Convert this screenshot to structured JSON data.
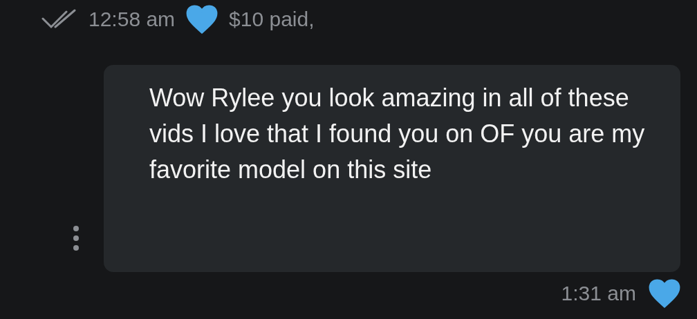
{
  "previous_message": {
    "price": "$10 paid,",
    "liked": true,
    "time": "12:58 am",
    "read": true
  },
  "message": {
    "text": "Wow Rylee you look amazing in all of these vids I love that I found you on OF you are my favorite model on this site",
    "liked": true,
    "time": "1:31 am"
  }
}
